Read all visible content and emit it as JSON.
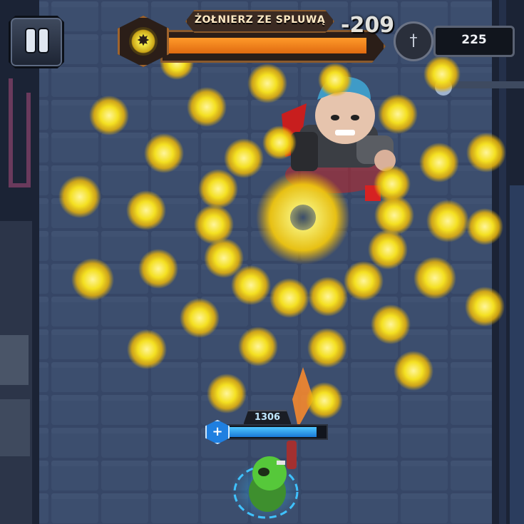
{
  "hud": {
    "pause_icon": "pause-icon",
    "boss": {
      "name": "ŻOŁNIERZ ZE SPLUWĄ",
      "icon": "explosion-burst-icon",
      "health_fraction": 0.96,
      "damage_popup": "-209"
    },
    "score": {
      "icon": "dagger-coin-icon",
      "value": "225"
    },
    "player": {
      "hp_value": "1306",
      "hp_fraction": 0.92,
      "medic_icon": "plus-icon"
    }
  },
  "colors": {
    "bullet_yellow": "#f4e021",
    "boss_bar": "#f08c1f",
    "player_bar": "#2e9bf0",
    "floor": "#3b4d6e"
  }
}
